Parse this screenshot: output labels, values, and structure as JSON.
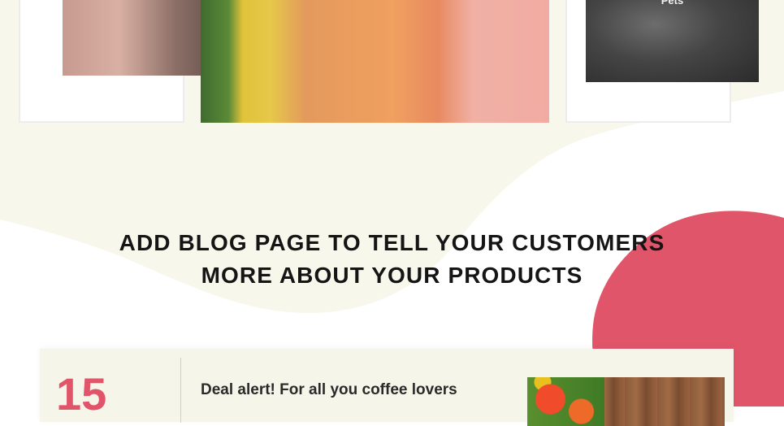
{
  "gallery": {
    "right_label": "Pets"
  },
  "blog_section": {
    "heading_line1": "ADD BLOG PAGE TO TELL YOUR CUSTOMERS",
    "heading_line2": "MORE ABOUT YOUR PRODUCTS",
    "post": {
      "day": "15",
      "title": "Deal alert! For all you coffee lovers"
    }
  },
  "colors": {
    "accent": "#e05569",
    "cream": "#f6f5ea",
    "heading": "#151515"
  }
}
